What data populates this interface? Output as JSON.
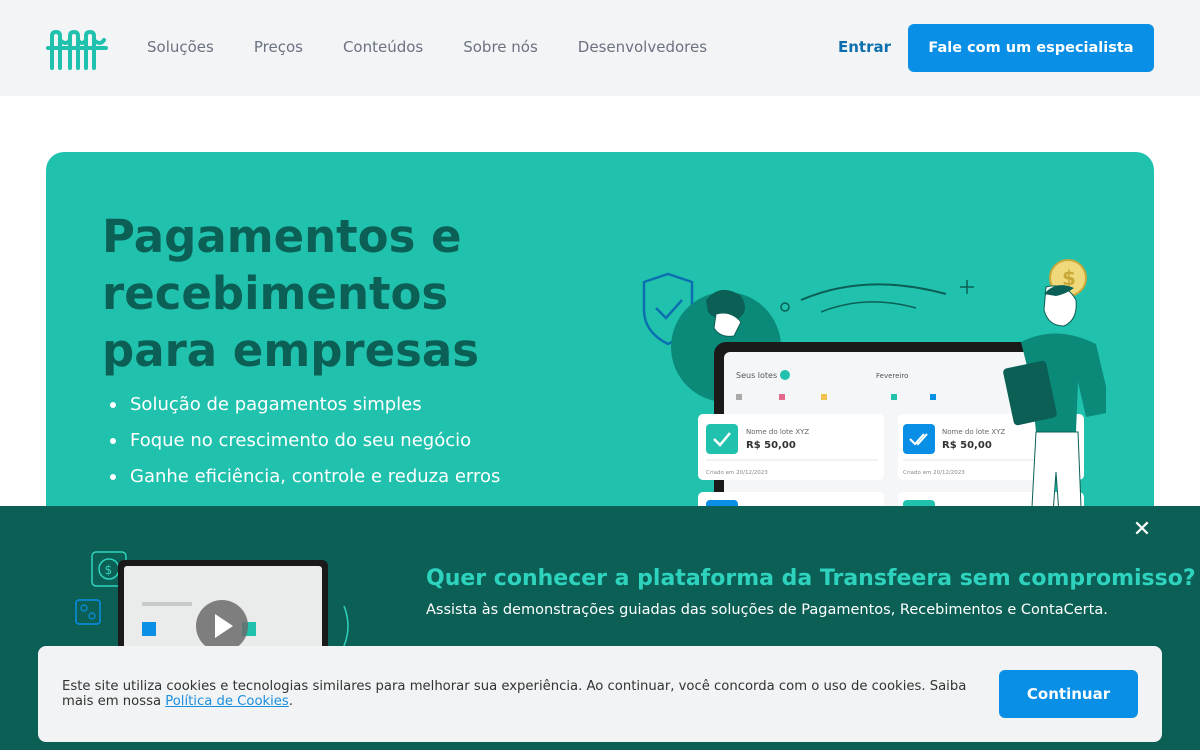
{
  "header": {
    "nav": [
      "Soluções",
      "Preços",
      "Conteúdos",
      "Sobre nós",
      "Desenvolvedores"
    ],
    "login_label": "Entrar",
    "cta_label": "Fale com um especialista"
  },
  "hero": {
    "title": "Pagamentos e recebimentos para empresas",
    "bullets": [
      "Solução de pagamentos simples",
      "Foque no crescimento do seu negócio",
      "Ganhe eficiência, controle e reduza erros"
    ],
    "mockup": {
      "lots_title": "Seus lotes",
      "month": "Fevereiro",
      "card1_name": "Nome do lote XYZ",
      "card1_value": "R$ 50,00",
      "card1_date": "Criado em 20/12/2023",
      "card2_name": "Nome do lote XYZ",
      "card2_value": "R$ 50,00",
      "card2_date": "Criado em 20/12/2023"
    }
  },
  "promo": {
    "title": "Quer conhecer a plataforma da Transfeera sem compromisso?",
    "subtitle": "Assista às demonstrações guiadas das soluções de Pagamentos, Recebimentos e ContaCerta.",
    "close_label": "✕"
  },
  "cookie": {
    "text": "Este site utiliza cookies e tecnologias similares para melhorar sua experiência. Ao continuar, você concorda com o uso de cookies. Saiba mais em nossa ",
    "link_label": "Política de Cookies",
    "suffix": ".",
    "button_label": "Continuar"
  },
  "colors": {
    "brand_teal": "#20c2ae",
    "dark_teal": "#0b5f55",
    "accent_blue": "#0a8fe6"
  }
}
